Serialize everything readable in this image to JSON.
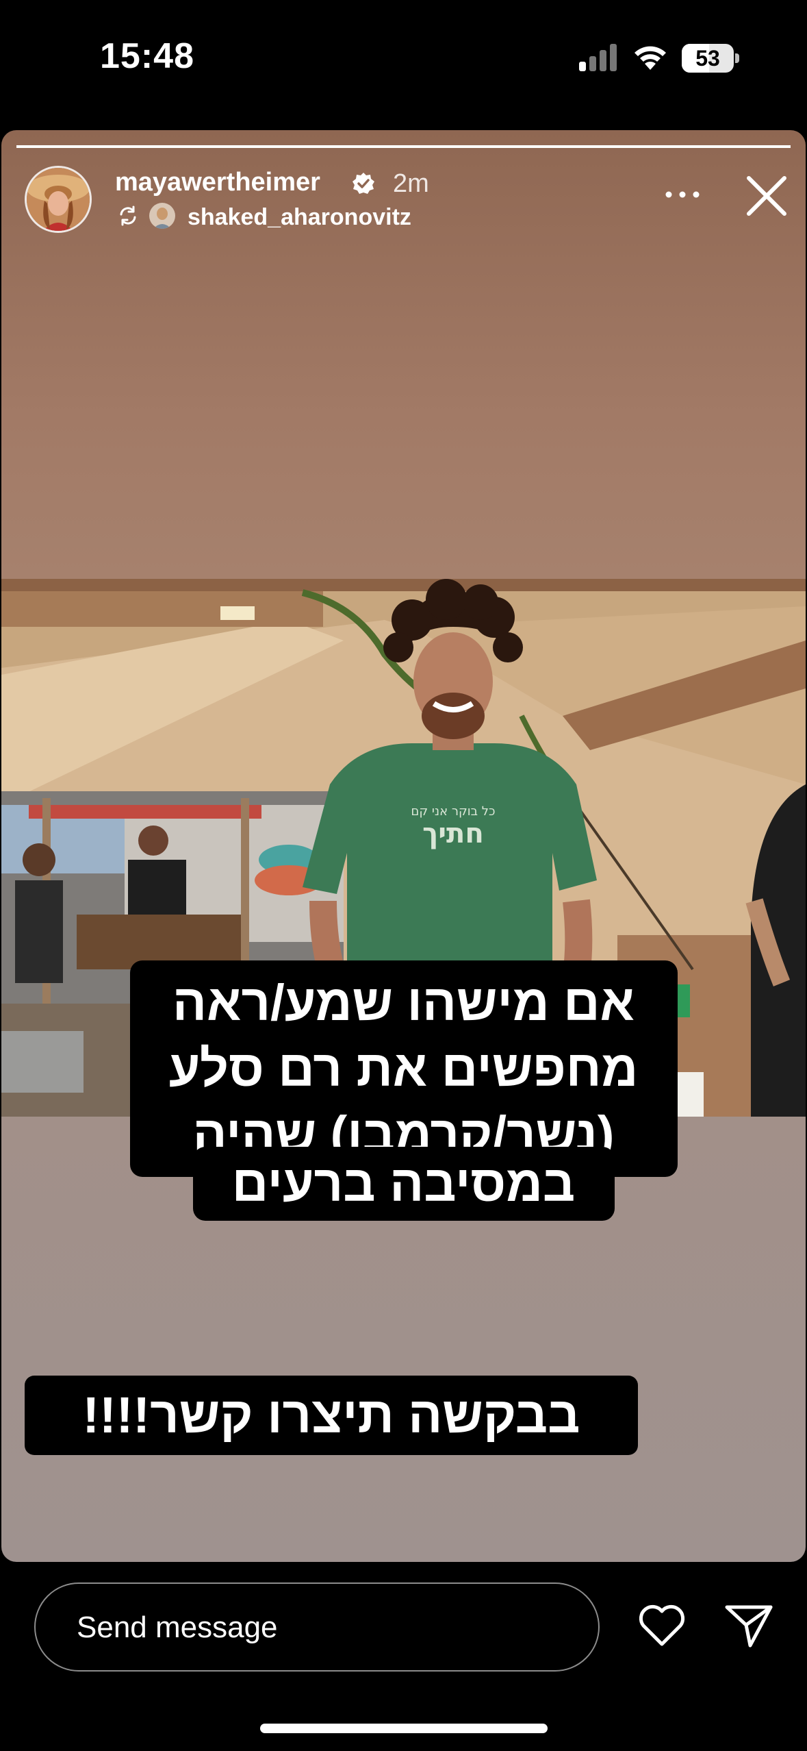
{
  "status_bar": {
    "time": "15:48",
    "battery_level": "53"
  },
  "story": {
    "progress": 1.0,
    "author": {
      "username": "mayawertheimer",
      "verified": true,
      "time_ago": "2m"
    },
    "reposted_from": {
      "username": "shaked_aharonovitz"
    },
    "photo": {
      "shirt_text_line1": "כל בוקר אני קם",
      "shirt_text_line2": "חתיך"
    },
    "caption_lines": [
      "אם מישהו שמע/ראה",
      "מחפשים את רם סלע",
      "(נשר/קרמבו) שהיה",
      "במסיבה ברעים"
    ],
    "caption_extra": "בבקשה תיצרו קשר!!!!"
  },
  "composer": {
    "placeholder": "Send message"
  },
  "icons": {
    "more": "more-horizontal-icon",
    "close": "close-icon",
    "like": "heart-icon",
    "share": "send-icon",
    "repost": "repost-icon",
    "verified": "verified-badge-icon"
  },
  "colors": {
    "background": "#000000",
    "story_top": "#8f6752",
    "story_bottom": "#9f928f",
    "caption_bg": "#000000"
  }
}
